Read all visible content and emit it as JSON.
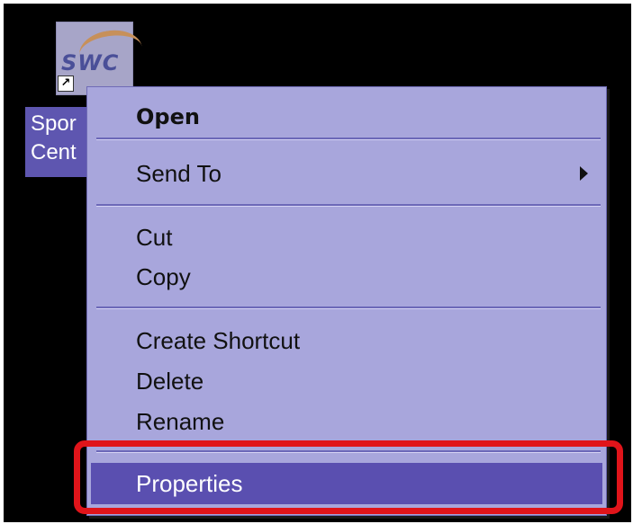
{
  "desktop": {
    "icon": {
      "logo_text": "SWC",
      "label": "Spor\nCent",
      "accent_color": "#5e56b0"
    }
  },
  "context_menu": {
    "items": [
      {
        "label": "Open",
        "bold": true
      },
      {
        "label": "Send To",
        "has_submenu": true
      },
      {
        "label": "Cut"
      },
      {
        "label": "Copy"
      },
      {
        "label": "Create Shortcut"
      },
      {
        "label": "Delete"
      },
      {
        "label": "Rename"
      },
      {
        "label": "Properties",
        "highlighted": true
      }
    ],
    "background_color": "#a8a6dc",
    "highlight_color": "#5a4fb0"
  },
  "annotation": {
    "highlight_color": "#e0141a"
  }
}
